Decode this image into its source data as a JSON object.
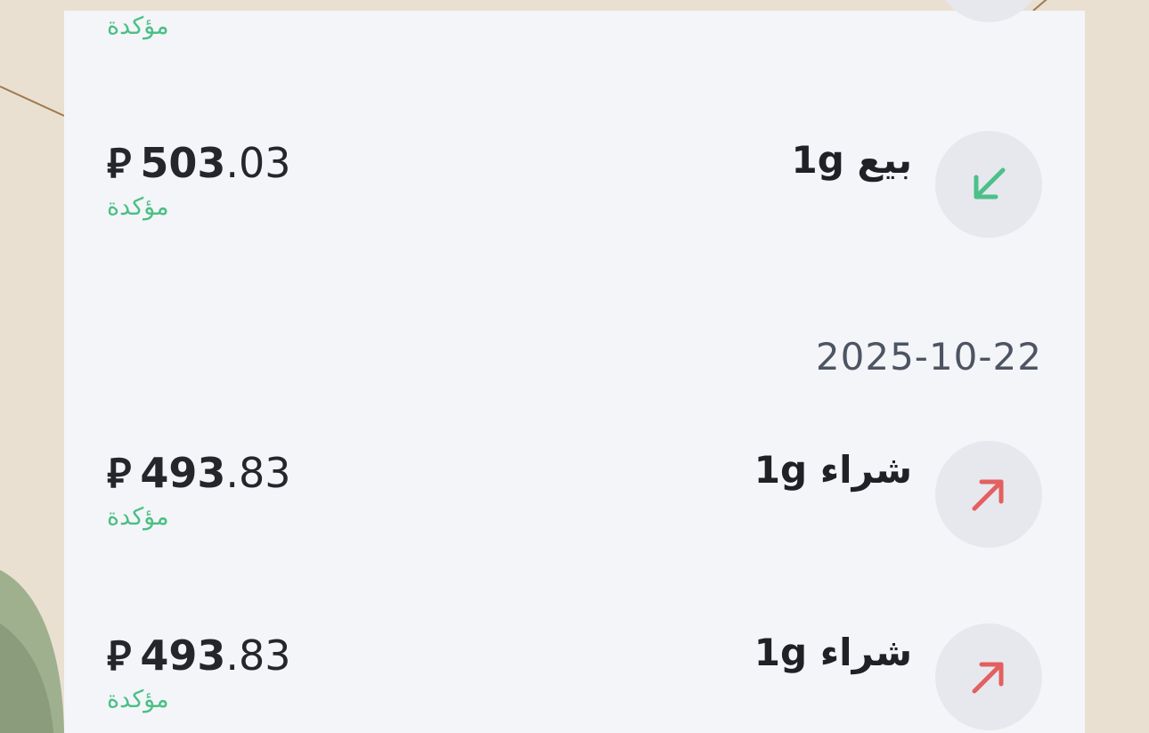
{
  "currency_symbol": "⃁",
  "colors": {
    "confirmed": "#4bbf85",
    "sell_arrow": "#4cc08a",
    "buy_arrow": "#e45f5f",
    "panel_bg": "#f3f5f9"
  },
  "transactions": [
    {
      "title": "",
      "amount_int": "",
      "amount_dec": "",
      "status": "مؤكدة",
      "icon": "arrow-down-left-icon"
    },
    {
      "title": "بيع 1g",
      "amount_int": "503",
      "amount_dec": ".03",
      "status": "مؤكدة",
      "icon": "arrow-down-left-icon"
    },
    {
      "title": "شراء 1g",
      "amount_int": "493",
      "amount_dec": ".83",
      "status": "مؤكدة",
      "icon": "arrow-up-right-icon"
    },
    {
      "title": "شراء 1g",
      "amount_int": "493",
      "amount_dec": ".83",
      "status": "مؤكدة",
      "icon": "arrow-up-right-icon"
    }
  ],
  "date_groups": [
    "2025-10-22"
  ]
}
